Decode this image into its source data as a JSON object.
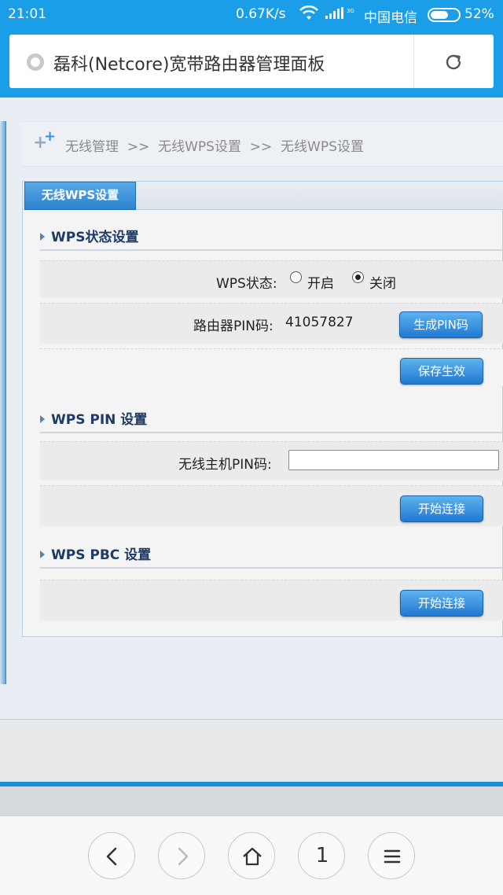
{
  "status_bar": {
    "time": "21:01",
    "speed": "0.67K/s",
    "carrier": "中国电信",
    "battery": "52%",
    "network_small": "3G"
  },
  "browser": {
    "page_title": "磊科(Netcore)宽带路由器管理面板"
  },
  "breadcrumb": {
    "text": "无线管理  >>  无线WPS设置  >>  无线WPS设置"
  },
  "panel": {
    "tab_label": "无线WPS设置",
    "wps_status_section": {
      "title": "WPS状态设置",
      "status_label": "WPS状态:",
      "options": [
        "开启",
        "关闭"
      ],
      "selected": "关闭",
      "pin_label": "路由器PIN码:",
      "pin_value": "41057827",
      "generate_pin_button": "生成PIN码",
      "save_button": "保存生效"
    },
    "wps_pin_section": {
      "title": "WPS PIN 设置",
      "host_pin_label": "无线主机PIN码:",
      "host_pin_value": "",
      "connect_button": "开始连接"
    },
    "wps_pbc_section": {
      "title": "WPS PBC 设置",
      "connect_button": "开始连接"
    }
  },
  "bottom_nav": {
    "tabs_count": "1"
  },
  "colors": {
    "accent": "#1a9ee8",
    "button": "#2b84cf",
    "section_title": "#1d3b66"
  }
}
